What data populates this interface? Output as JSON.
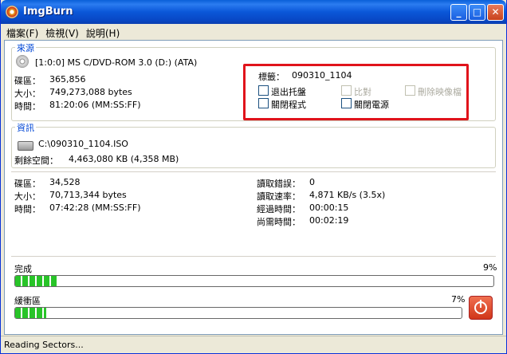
{
  "window": {
    "title": "ImgBurn"
  },
  "menu": [
    {
      "label": "檔案(F)"
    },
    {
      "label": "檢視(V)"
    },
    {
      "label": "說明(H)"
    }
  ],
  "source": {
    "title": "來源",
    "device": "[1:0:0] MS C/DVD-ROM 3.0 (D:) (ATA)",
    "sectors_label": "碟區：",
    "sectors_value": "365,856",
    "size_label": "大小：",
    "size_value": "749,273,088 bytes",
    "time_label": "時間：",
    "time_value": "81:20:06 (MM:SS:FF)",
    "volume_label_label": "標籤：",
    "volume_label_value": "090310_1104",
    "options": [
      {
        "label": "退出托盤",
        "checked": false,
        "enabled": true
      },
      {
        "label": "比對",
        "checked": false,
        "enabled": false
      },
      {
        "label": "刪除映像檔",
        "checked": false,
        "enabled": false
      },
      {
        "label": "關閉程式",
        "checked": false,
        "enabled": true
      },
      {
        "label": "關閉電源",
        "checked": false,
        "enabled": true
      }
    ]
  },
  "info": {
    "title": "資訊",
    "output_path": "C:\\090310_1104.ISO",
    "free_space_label": "剩餘空間：",
    "free_space_value": "4,463,080 KB  (4,358 MB)",
    "sectors_label": "碟區：",
    "sectors_value": "34,528",
    "size_label": "大小：",
    "size_value": "70,713,344 bytes",
    "time_label": "時間：",
    "time_value": "07:42:28 (MM:SS:FF)",
    "read_errors_label": "讀取錯誤：",
    "read_errors_value": "0",
    "read_rate_label": "讀取速率：",
    "read_rate_value": "4,871 KB/s (3.5x)",
    "elapsed_label": "經過時間：",
    "elapsed_value": "00:00:15",
    "remaining_label": "尚需時間：",
    "remaining_value": "00:02:19"
  },
  "progress": {
    "complete_label": "完成",
    "complete_percent": "9%",
    "complete_fraction": 0.09,
    "buffer_label": "緩衝區",
    "buffer_percent": "7%",
    "buffer_fraction": 0.07
  },
  "status": {
    "text": "Reading Sectors..."
  },
  "colors": {
    "titlebar": "#0a57d8",
    "progress_fill": "#28c428",
    "highlight_box": "#e0131b",
    "stop_button": "#d0361a"
  }
}
